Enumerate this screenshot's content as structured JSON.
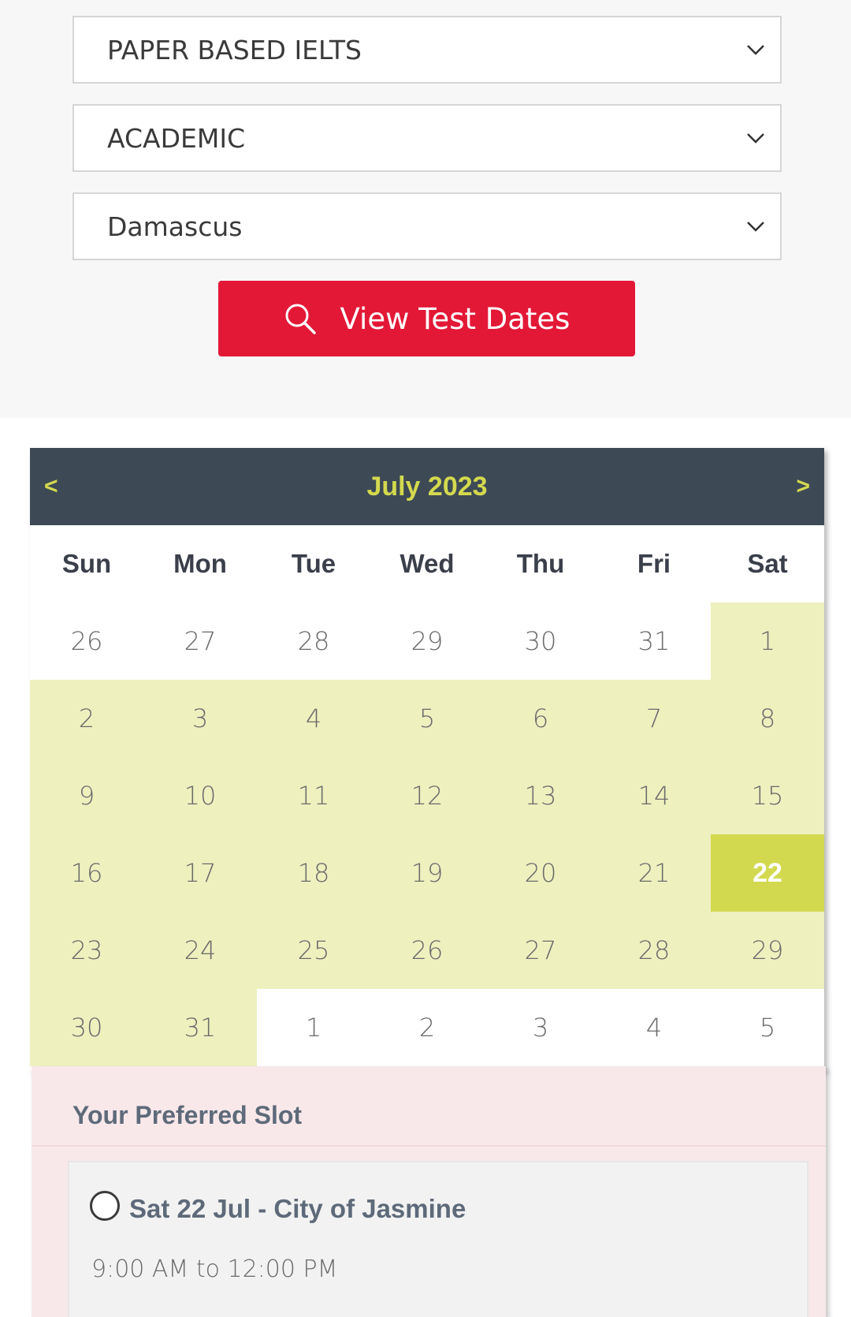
{
  "filters": {
    "test_type": "PAPER BASED IELTS",
    "module": "ACADEMIC",
    "city": "Damascus"
  },
  "search_button": {
    "label": "View Test Dates",
    "icon": "search-icon"
  },
  "calendar": {
    "title": "July 2023",
    "prev": "<",
    "next": ">",
    "weekdays": [
      "Sun",
      "Mon",
      "Tue",
      "Wed",
      "Thu",
      "Fri",
      "Sat"
    ],
    "weeks": [
      [
        "26",
        "27",
        "28",
        "29",
        "30",
        "31",
        "1"
      ],
      [
        "2",
        "3",
        "4",
        "5",
        "6",
        "7",
        "8"
      ],
      [
        "9",
        "10",
        "11",
        "12",
        "13",
        "14",
        "15"
      ],
      [
        "16",
        "17",
        "18",
        "19",
        "20",
        "21",
        "22"
      ],
      [
        "23",
        "24",
        "25",
        "26",
        "27",
        "28",
        "29"
      ],
      [
        "30",
        "31",
        "1",
        "2",
        "3",
        "4",
        "5"
      ]
    ],
    "selected_day": "22",
    "colors": {
      "header_bg": "#3d4a55",
      "accent": "#d4d94e",
      "in_month_bg": "#eef0be",
      "selected_bg": "#d3d94f"
    }
  },
  "slots": {
    "title": "Your Preferred Slot",
    "items": [
      {
        "label": "Sat 22 Jul - City of Jasmine",
        "time": "9:00 AM to 12:00 PM"
      }
    ]
  },
  "colors": {
    "primary_button": "#e31837"
  }
}
